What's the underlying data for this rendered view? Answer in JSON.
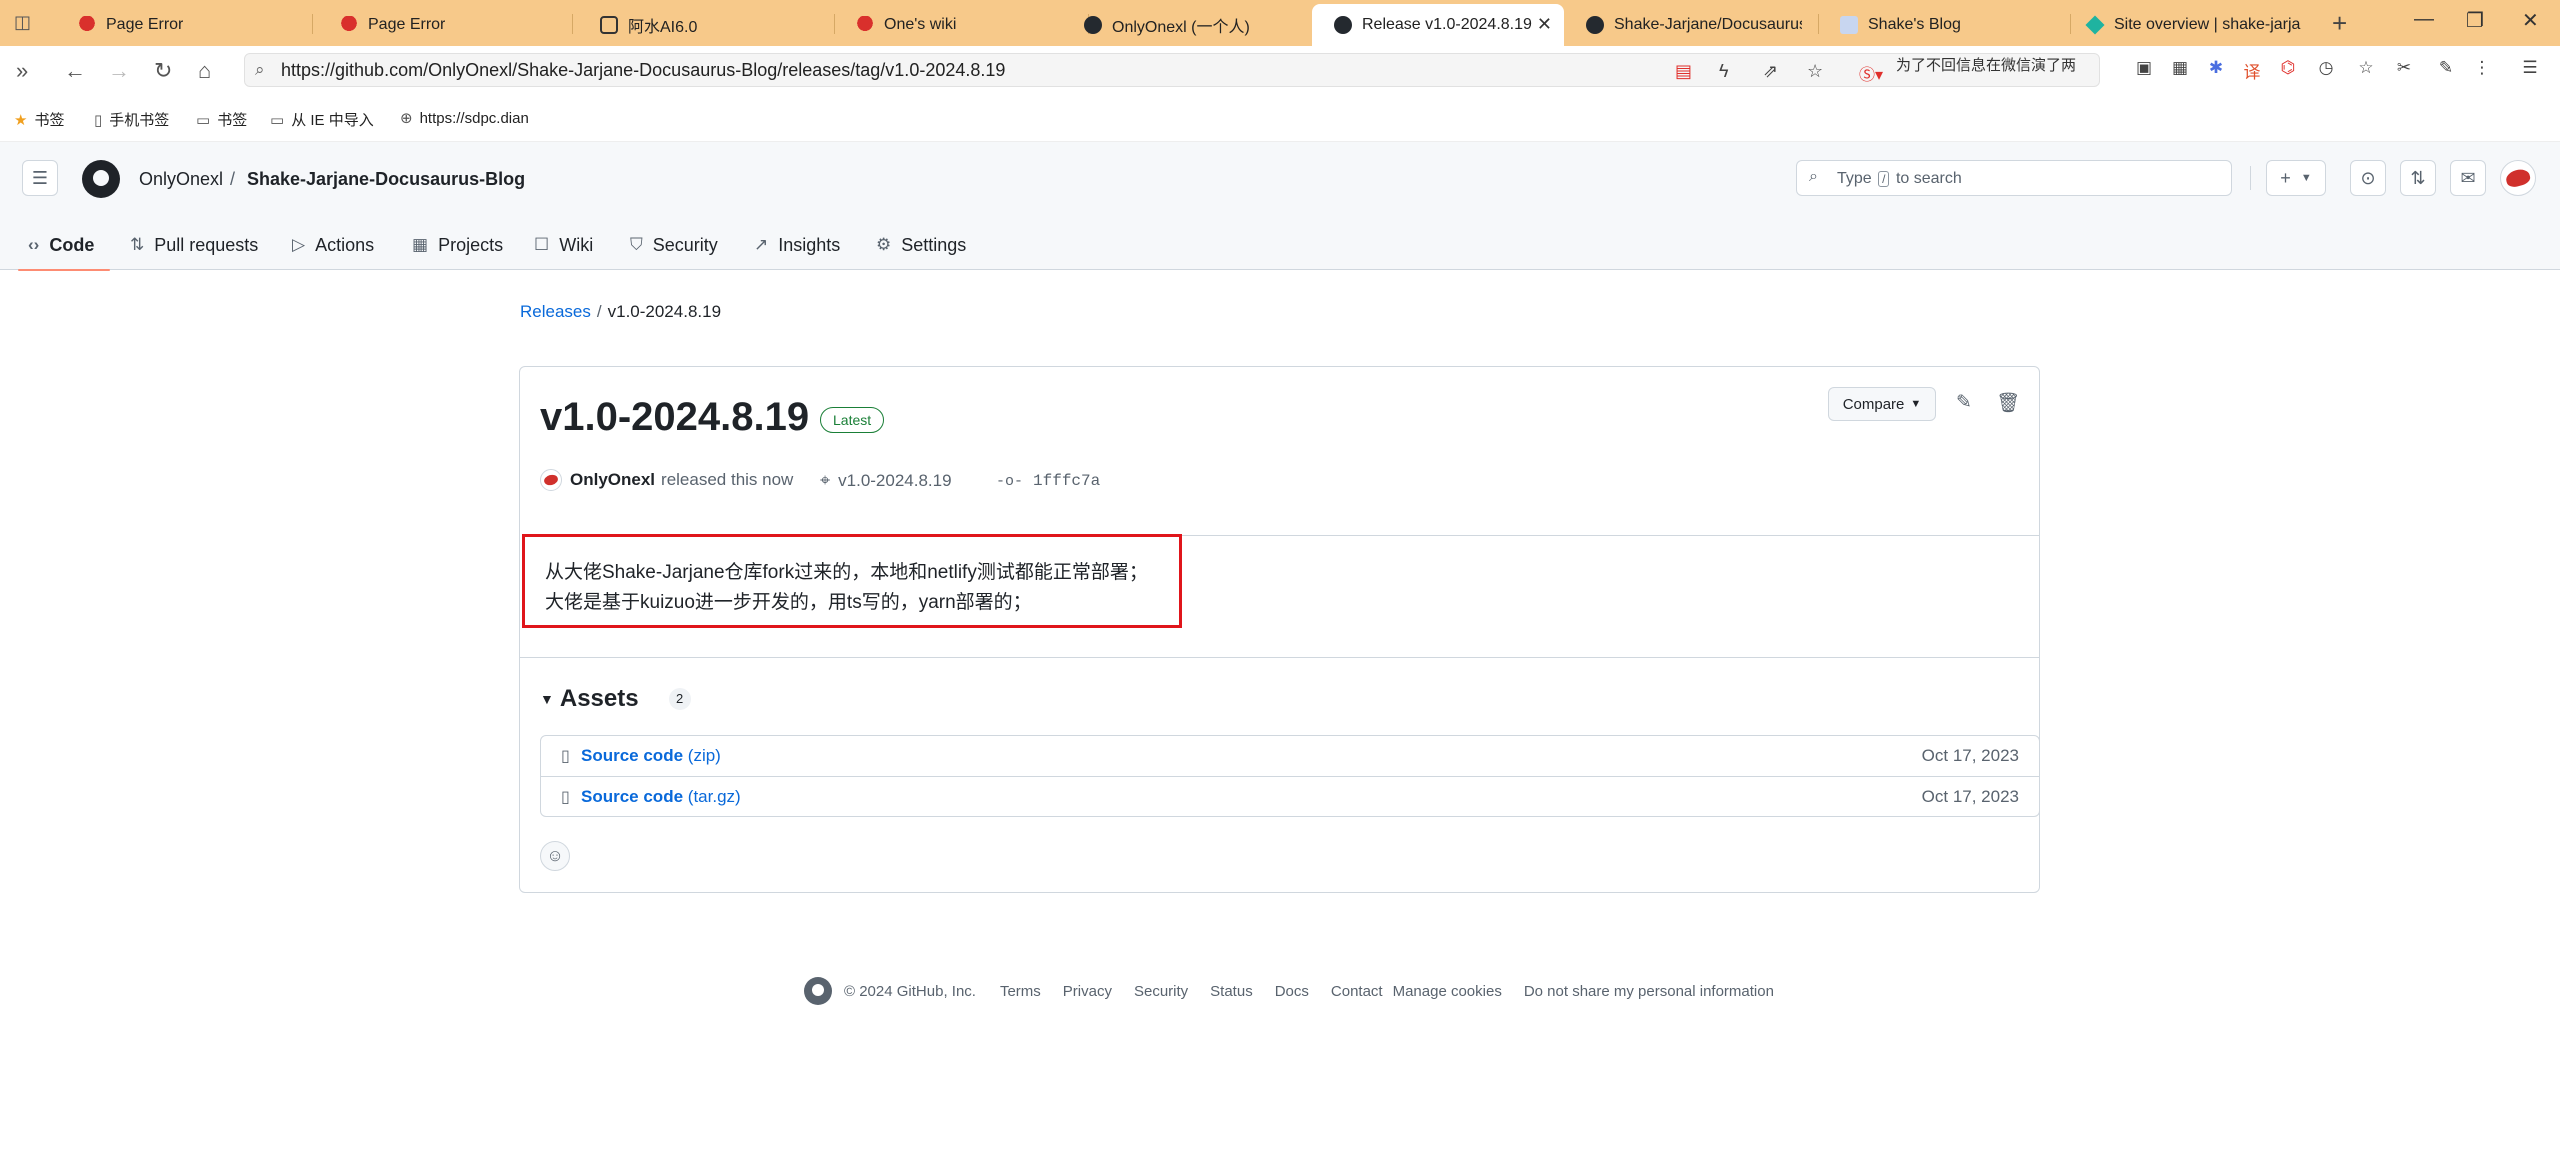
{
  "browser": {
    "tabs": [
      {
        "title": "Page Error",
        "icon": "red-pin-icon"
      },
      {
        "title": "Page Error",
        "icon": "red-pin-icon"
      },
      {
        "title": "阿水AI6.0",
        "icon": "app-icon"
      },
      {
        "title": "One's wiki",
        "icon": "red-pin-icon"
      },
      {
        "title": "OnlyOnexl (一个人)",
        "icon": "github-icon"
      },
      {
        "title": "Release v1.0-2024.8.19",
        "icon": "github-icon",
        "active": true
      },
      {
        "title": "Shake-Jarjane/Docusaurus",
        "icon": "github-icon"
      },
      {
        "title": "Shake's Blog",
        "icon": "image-icon"
      },
      {
        "title": "Site overview | shake-jarja",
        "icon": "netlify-icon"
      }
    ],
    "url": "https://github.com/OnlyOnexl/Shake-Jarjane-Docusaurus-Blog/releases/tag/v1.0-2024.8.19",
    "url_hint": "为了不回信息在微信演了两",
    "bookmarks": [
      {
        "label": "书签",
        "icon": "star-icon"
      },
      {
        "label": "手机书签",
        "icon": "phone-icon"
      },
      {
        "label": "书签",
        "icon": "folder-icon"
      },
      {
        "label": "从 IE 中导入",
        "icon": "folder-icon"
      },
      {
        "label": "https://sdpc.dian",
        "icon": "globe-icon"
      }
    ]
  },
  "github": {
    "owner": "OnlyOnexl",
    "separator": "/",
    "repo": "Shake-Jarjane-Docusaurus-Blog",
    "search_prefix": "Type",
    "search_key": "/",
    "search_suffix": "to search",
    "nav": [
      {
        "label": "Code",
        "icon": "code-icon",
        "selected": true
      },
      {
        "label": "Pull requests",
        "icon": "pull-request-icon"
      },
      {
        "label": "Actions",
        "icon": "play-icon"
      },
      {
        "label": "Projects",
        "icon": "table-icon"
      },
      {
        "label": "Wiki",
        "icon": "book-icon"
      },
      {
        "label": "Security",
        "icon": "shield-icon"
      },
      {
        "label": "Insights",
        "icon": "graph-icon"
      },
      {
        "label": "Settings",
        "icon": "gear-icon"
      }
    ]
  },
  "release": {
    "breadcrumb_root": "Releases",
    "breadcrumb_sep": "/",
    "breadcrumb_current": "v1.0-2024.8.19",
    "title": "v1.0-2024.8.19",
    "badge": "Latest",
    "compare_label": "Compare",
    "author": "OnlyOnexl",
    "released_text": "released this now",
    "tag": "v1.0-2024.8.19",
    "commit": "1fffc7a",
    "notes": [
      "从大佬Shake-Jarjane仓库fork过来的，本地和netlify测试都能正常部署；",
      "大佬是基于kuizuo进一步开发的，用ts写的，yarn部署的；"
    ],
    "assets_title": "Assets",
    "assets_count": "2",
    "assets": [
      {
        "name": "Source code",
        "ext": "(zip)",
        "date": "Oct 17, 2023"
      },
      {
        "name": "Source code",
        "ext": "(tar.gz)",
        "date": "Oct 17, 2023"
      }
    ]
  },
  "footer": {
    "copyright": "© 2024 GitHub, Inc.",
    "links": [
      "Terms",
      "Privacy",
      "Security",
      "Status",
      "Docs",
      "Contact",
      "Manage cookies",
      "Do not share my personal information"
    ]
  },
  "colors": {
    "tabbar": "#f7c98a",
    "link": "#0969da",
    "latest_badge": "#1a7f37",
    "highlight_border": "#e0151b",
    "nav_underline": "#fd8c73"
  }
}
